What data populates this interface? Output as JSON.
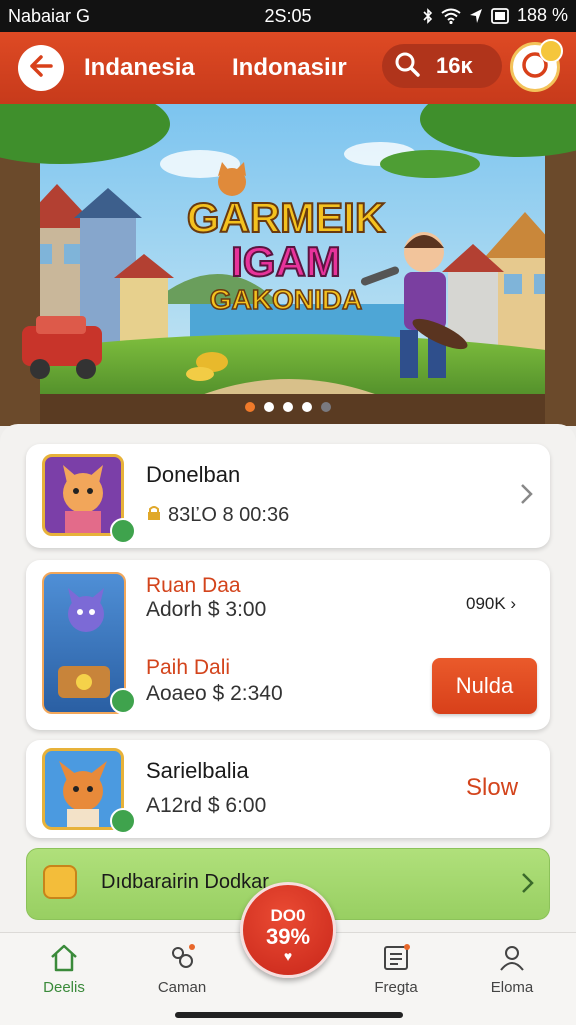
{
  "status_bar": {
    "carrier": "Nabaiar G",
    "time": "2S:05",
    "battery": "188 %"
  },
  "header": {
    "title_1": "Indanesia",
    "title_2": "Indonasiır",
    "search_count": "16ĸ"
  },
  "banner": {
    "line_1": "GARMEIK",
    "line_2": "IGAM",
    "line_3": "GAKONIDA",
    "dots": 5,
    "active_dot": 0
  },
  "cards": [
    {
      "name": "Donelban",
      "stats": "83ĽO  8  00:36"
    },
    {
      "title_1": "Ruan Daa",
      "line_1": "Adorh $ 3:00",
      "side_value": "090K ›",
      "title_2": "Paih Dali",
      "line_2": "Aoaeo $ 2:340",
      "button": "Nulda"
    },
    {
      "name": "Sarielbalia",
      "line": "A12rd $ 6:00",
      "action": "Slow"
    }
  ],
  "promo": {
    "label": "Dıdbarairin Dodkar"
  },
  "fab": {
    "line_1": "DO0",
    "line_2": "39%",
    "line_3": "♥"
  },
  "tabs": [
    {
      "label": "Deelis",
      "icon": "home-icon",
      "active": true
    },
    {
      "label": "Caman",
      "icon": "puzzle-icon",
      "active": false
    },
    {
      "label": "Fregta",
      "icon": "notes-icon",
      "active": false
    },
    {
      "label": "Eloma",
      "icon": "person-icon",
      "active": false
    }
  ],
  "colors": {
    "accent": "#d8401a",
    "header": "#de4a24",
    "tab_active": "#3a8a3a",
    "promo": "#a5d970"
  }
}
